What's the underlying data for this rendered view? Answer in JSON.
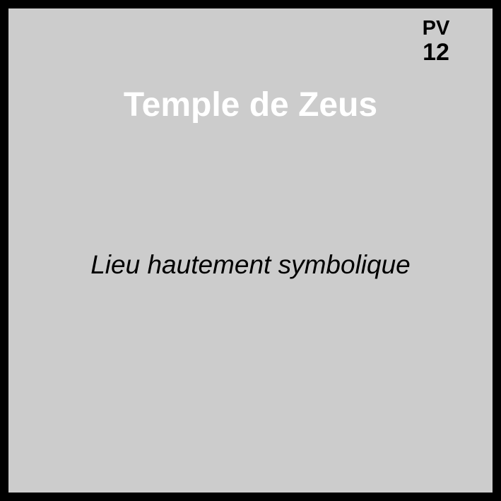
{
  "card": {
    "pv_label": "PV",
    "pv_value": "12",
    "title": "Temple de Zeus",
    "subtitle": "Lieu hautement symbolique"
  },
  "colors": {
    "border": "#000000",
    "background": "#cccccc",
    "title": "#ffffff",
    "text": "#000000"
  }
}
